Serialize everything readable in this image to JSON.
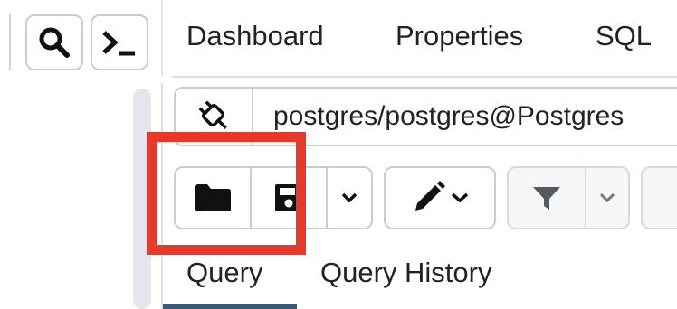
{
  "header": {
    "tabs": [
      {
        "label": "Dashboard"
      },
      {
        "label": "Properties"
      },
      {
        "label": "SQL"
      }
    ]
  },
  "connection": {
    "label": "postgres/postgres@Postgres"
  },
  "query_tool": {
    "tabs": [
      {
        "label": "Query",
        "active": true
      },
      {
        "label": "Query History",
        "active": false
      }
    ]
  },
  "icons": {
    "search": "search-icon",
    "terminal": "terminal-icon",
    "plug": "plug-icon",
    "open": "folder-icon",
    "save": "save-icon",
    "edit": "pencil-icon",
    "filter": "filter-icon"
  },
  "colors": {
    "highlight": "#e8382a",
    "active_tab": "#3b5a78",
    "border": "#c8cdd3"
  }
}
